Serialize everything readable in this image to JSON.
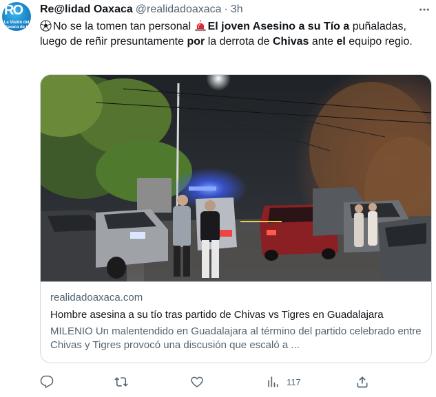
{
  "tweet": {
    "display_name": "Re@lidad Oaxaca",
    "handle": "@realidadoaxaca",
    "separator": "·",
    "time": "3h",
    "avatar_text": {
      "logo": "RO",
      "line1": "La Visión del",
      "line2": "Oaxaca de H"
    },
    "text": {
      "s1": "No se la tomen tan personal ",
      "s2": "El joven Asesino a su Tío a",
      "s3": " puñaladas, luego de reñir presuntamente ",
      "s4": "por",
      "s5": " la derrota de ",
      "s6": "Chivas",
      "s7": " ante ",
      "s8": "el",
      "s9": " equipo regio."
    },
    "emoji": [
      "soccer-ball",
      "police-light"
    ],
    "card": {
      "domain": "realidadoaxaca.com",
      "title": "Hombre asesina a su tío tras partido de Chivas vs Tigres en Guadalajara",
      "description": "MILENIO Un malentendido en Guadalajara al término del partido celebrado entre Chivas y Tigres provocó una discusión que escaló a ..."
    },
    "actions": {
      "reply_icon": "reply-icon",
      "retweet_icon": "retweet-icon",
      "like_icon": "like-icon",
      "views_icon": "views-icon",
      "views_count": "117",
      "share_icon": "share-icon"
    }
  },
  "colors": {
    "text": "#0f1419",
    "secondary": "#536471",
    "border": "#cfd9de"
  }
}
